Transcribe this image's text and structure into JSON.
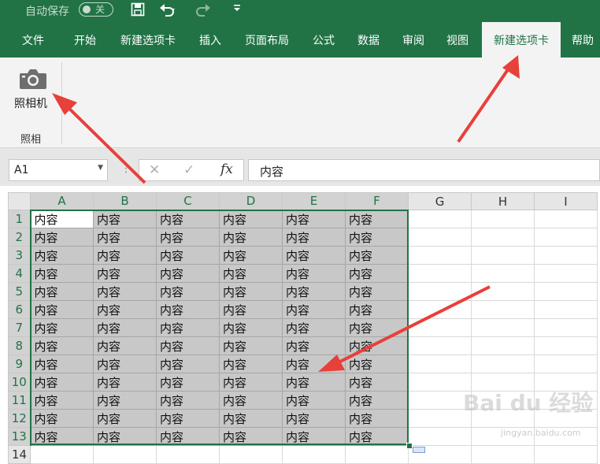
{
  "qat": {
    "autosave_label": "自动保存",
    "autosave_state": "关",
    "save_icon": "save-icon",
    "undo_icon": "undo-icon",
    "redo_icon": "redo-icon",
    "customize_icon": "customize-qat-icon"
  },
  "tabs": [
    "文件",
    "开始",
    "新建选项卡",
    "插入",
    "页面布局",
    "公式",
    "数据",
    "审阅",
    "视图",
    "新建选项卡",
    "帮助"
  ],
  "active_tab_index": 9,
  "ribbon": {
    "camera_label": "照相机",
    "group_label": "照相",
    "camera_icon": "camera-icon"
  },
  "formula_bar": {
    "name_box": "A1",
    "cancel_symbol": "✕",
    "enter_symbol": "✓",
    "fx_label": "fx",
    "content": "内容"
  },
  "sheet": {
    "columns": [
      "A",
      "B",
      "C",
      "D",
      "E",
      "F",
      "G",
      "H",
      "I"
    ],
    "rows": [
      "1",
      "2",
      "3",
      "4",
      "5",
      "6",
      "7",
      "8",
      "9",
      "10",
      "11",
      "12",
      "13",
      "14"
    ],
    "cell_text": "内容",
    "selected_range": "A1:F13"
  },
  "watermark": {
    "logo": "Bai du 经验",
    "url": "jingyan.baidu.com"
  },
  "colors": {
    "accent": "#217346",
    "selection_fill": "#c8c8c8",
    "arrow": "#e8403a"
  }
}
